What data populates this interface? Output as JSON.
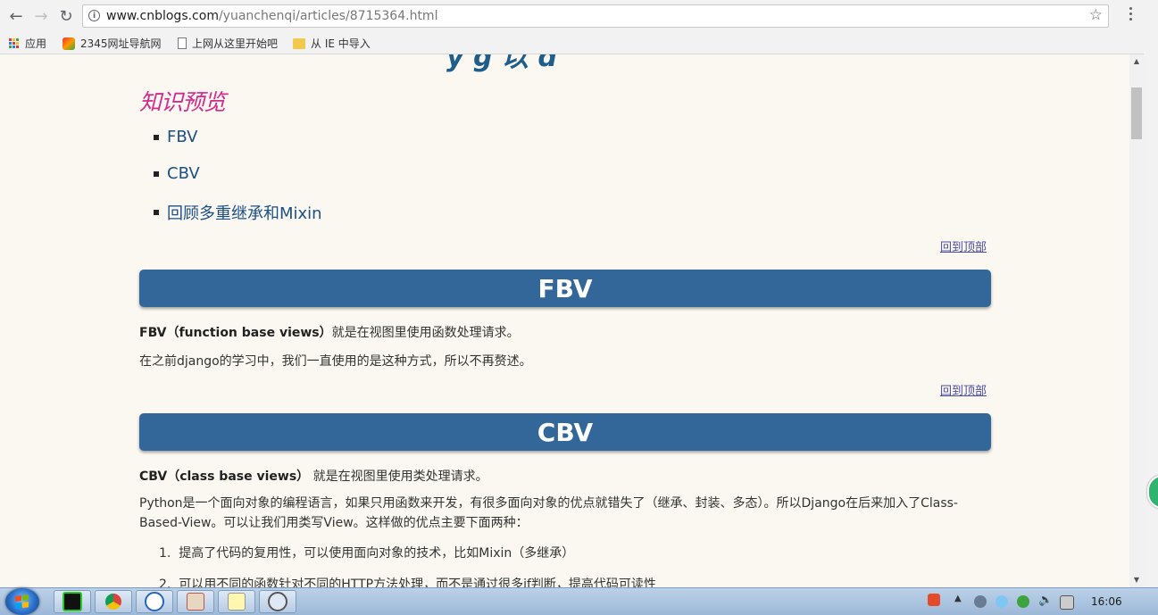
{
  "browser": {
    "url_host": "www.cnblogs.com",
    "url_path": "/yuanchenqi/articles/8715364.html",
    "bookmarks": [
      "应用",
      "2345网址导航网",
      "上网从这里开始吧",
      "从 IE 中导入"
    ]
  },
  "article": {
    "section_title": "知识预览",
    "toc": [
      "FBV",
      "CBV",
      "回顾多重继承和Mixin"
    ],
    "back_to_top": "回到顶部",
    "fbv": {
      "banner": "FBV",
      "term": "FBV（function base views）",
      "desc": "就是在视图里使用函数处理请求。",
      "para2": "在之前django的学习中，我们一直使用的是这种方式，所以不再赘述。"
    },
    "cbv": {
      "banner": "CBV",
      "term": "CBV（class base views）",
      "desc": " 就是在视图里使用类处理请求。",
      "para2": "Python是一个面向对象的编程语言，如果只用函数来开发，有很多面向对象的优点就错失了（继承、封装、多态）。所以Django在后来加入了Class-Based-View。可以让我们用类写View。这样做的优点主要下面两种：",
      "list": [
        "提高了代码的复用性，可以使用面向对象的技术，比如Mixin（多继承）",
        "可以用不同的函数针对不同的HTTP方法处理，而不是通过很多if判断，提高代码可读性"
      ]
    }
  },
  "taskbar": {
    "clock": "16:06"
  },
  "colors": {
    "banner": "#336699",
    "heading_pink": "#d42a8c",
    "toc_link": "#1b4f86",
    "page_bg": "#faf8f1"
  }
}
